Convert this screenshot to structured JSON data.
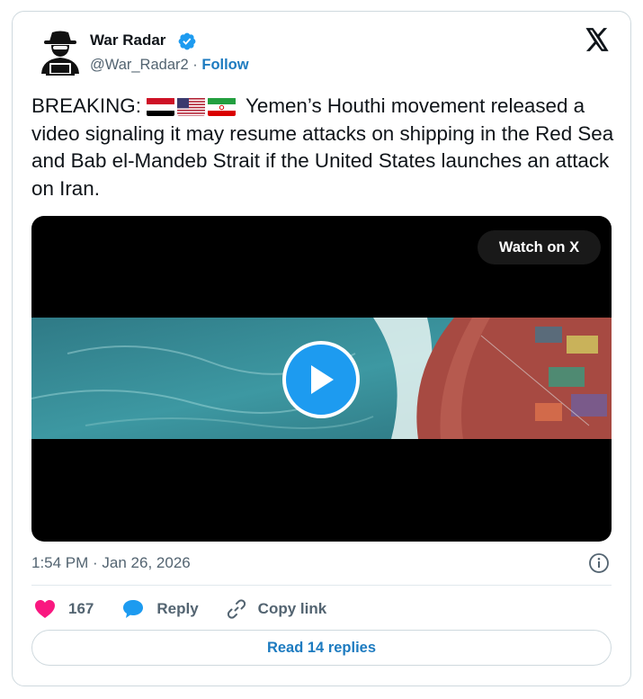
{
  "author": {
    "name": "War Radar",
    "handle": "@War_Radar2",
    "separator": " · ",
    "follow_label": "Follow",
    "verified": true
  },
  "platform": {
    "logo_icon": "x-logo-icon"
  },
  "tweet": {
    "prefix": "BREAKING:",
    "flags": [
      "yemen-flag",
      "us-flag",
      "iran-flag"
    ],
    "text": "Yemen’s Houthi movement released a video signaling it may resume attacks on shipping in the Red Sea and Bab el-Mandeb Strait if the United States launches an attack on Iran."
  },
  "video": {
    "watch_label": "Watch on X",
    "play_icon": "play-icon",
    "scene": "aerial view of cargo ship bow cutting through sea water"
  },
  "timestamp": "1:54 PM · Jan 26, 2026",
  "actions": {
    "like_count": "167",
    "reply_label": "Reply",
    "copy_label": "Copy link"
  },
  "read_replies_label": "Read 14 replies",
  "colors": {
    "accent": "#1d9bf0",
    "link": "#1d7bc0",
    "like": "#f91880",
    "muted": "#536471",
    "border": "#cfd9de"
  }
}
